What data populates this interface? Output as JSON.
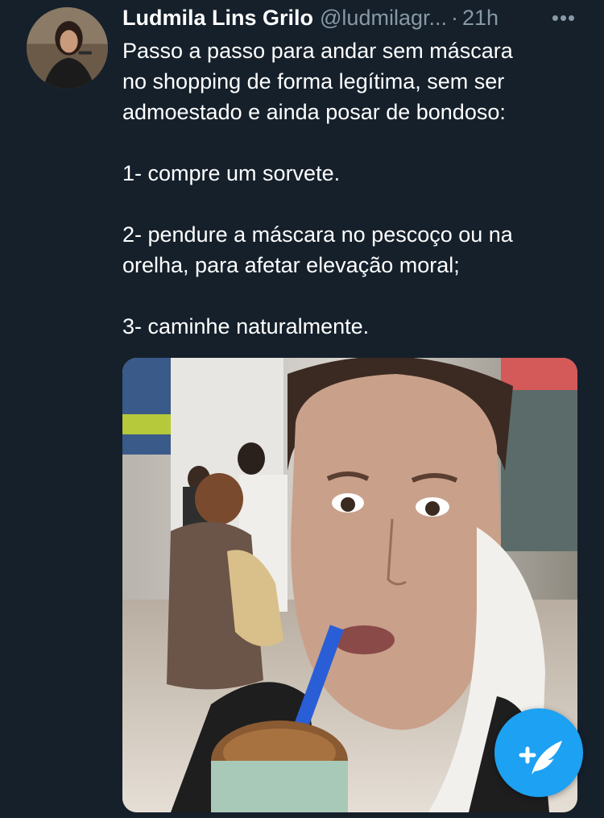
{
  "tweet": {
    "author_name": "Ludmila Lins Grilo",
    "handle": "@ludmilagr...",
    "separator": "·",
    "time": "21h",
    "more_icon": "more-horizontal-icon",
    "paragraphs": [
      [
        "Passo a passo para andar sem máscara",
        "no shopping de forma legítima, sem ser",
        "admoestado e ainda posar de bondoso:"
      ],
      [
        "1- compre um sorvete."
      ],
      [
        "2- pendure a máscara no pescoço ou na",
        "orelha, para afetar elevação moral;"
      ],
      [
        "3- caminhe naturalmente."
      ]
    ]
  },
  "compose_button": {
    "icon": "compose-feather-icon",
    "color": "#1da1f2"
  },
  "colors": {
    "background": "#15202b",
    "text": "#ffffff",
    "secondary_text": "#8899a6",
    "accent": "#1da1f2"
  }
}
